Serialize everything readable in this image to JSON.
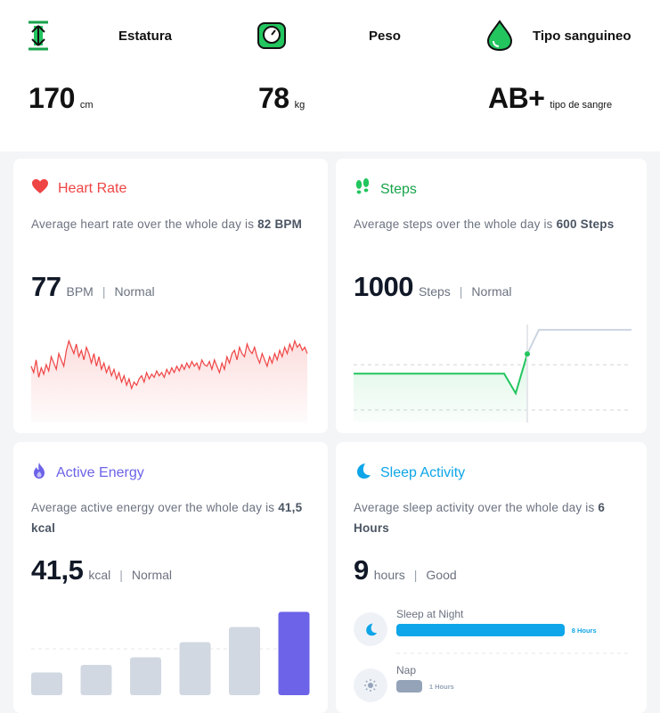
{
  "vitals": {
    "height": {
      "label": "Estatura",
      "value": "170",
      "unit": "cm",
      "icon": "height-arrows-icon"
    },
    "weight": {
      "label": "Peso",
      "value": "78",
      "unit": "kg",
      "icon": "scale-icon"
    },
    "blood": {
      "label": "Tipo sanguineo",
      "value": "AB+",
      "unit": "tipo de sangre",
      "icon": "blood-drop-icon"
    }
  },
  "colors": {
    "green": "#22c55e",
    "red": "#ef4444",
    "purple": "#6c63e8",
    "blue": "#0ea5e9",
    "gray": "#94a3b8"
  },
  "cards": {
    "heart": {
      "title": "Heart Rate",
      "desc": "Average heart rate over the whole day is ",
      "desc_bold": "82 BPM",
      "value": "77",
      "unit": "BPM",
      "sep": "|",
      "status": "Normal"
    },
    "steps": {
      "title": "Steps",
      "desc": "Average steps over the whole day is ",
      "desc_bold": "600 Steps",
      "value": "1000",
      "unit": "Steps",
      "sep": "|",
      "status": "Normal"
    },
    "energy": {
      "title": "Active Energy",
      "desc": "Average active energy over the whole day is ",
      "desc_bold": "41,5 kcal",
      "value": "41,5",
      "unit": "kcal",
      "sep": "|",
      "status": "Normal"
    },
    "sleep": {
      "title": "Sleep Activity",
      "desc": "Average sleep activity over the whole day is ",
      "desc_bold": "6 Hours",
      "value": "9",
      "unit": "hours",
      "sep": "|",
      "status": "Good",
      "rows": [
        {
          "label": "Sleep at Night",
          "value": "8 Hours",
          "fraction": 0.85
        },
        {
          "label": "Nap",
          "value": "1 Hours",
          "fraction": 0.13
        }
      ]
    }
  },
  "chart_data": [
    {
      "type": "line",
      "series": [
        {
          "values": [
            62,
            58,
            66,
            55,
            61,
            57,
            63,
            59,
            68,
            64,
            60,
            70,
            66,
            62,
            72,
            78,
            74,
            70,
            76,
            68,
            72,
            66,
            74,
            70,
            64,
            70,
            62,
            68,
            60,
            64,
            58,
            62,
            56,
            60,
            54,
            58,
            52,
            56,
            50,
            54,
            48,
            52,
            50,
            54,
            56,
            52,
            58,
            54,
            57,
            55,
            59,
            56,
            58,
            55,
            60,
            57,
            61,
            58,
            62,
            59,
            63,
            60,
            64,
            61,
            65,
            62,
            64,
            60,
            66,
            63,
            62,
            65,
            60,
            66,
            62,
            58,
            64,
            60,
            68,
            64,
            70,
            72,
            66,
            74,
            70,
            68,
            76,
            72,
            70,
            74,
            68,
            64,
            70,
            66,
            62,
            68,
            64,
            70,
            66,
            72,
            68,
            74,
            70,
            76,
            72,
            78,
            74,
            76,
            72,
            74,
            70
          ]
        }
      ]
    },
    {
      "type": "line",
      "series": [
        {
          "values": [
            600,
            600,
            600,
            600,
            600,
            600,
            600,
            600,
            600,
            600,
            600,
            600,
            600,
            600,
            420,
            780,
            1000,
            1000,
            1000,
            1000,
            1000,
            1000,
            1000,
            1000,
            1000
          ]
        }
      ]
    },
    {
      "type": "bar",
      "values": [
        12,
        16,
        20,
        28,
        36,
        44
      ],
      "highlight_index": 5
    }
  ]
}
